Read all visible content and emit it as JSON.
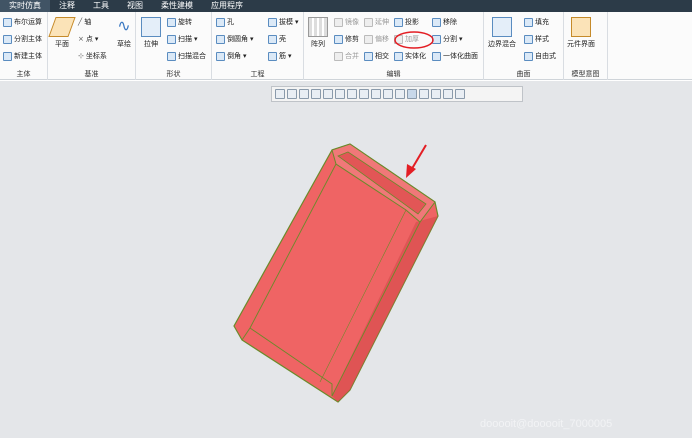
{
  "menu": [
    "实时仿真",
    "注释",
    "工具",
    "视图",
    "柔性建模",
    "应用程序"
  ],
  "ribbon": {
    "groups": {
      "boolean": {
        "label": "主体",
        "items": [
          "布尔运算",
          "分割主体",
          "新建主体"
        ]
      },
      "datum": {
        "label": "基准",
        "plane": "平面",
        "axis": "轴",
        "point": "点",
        "csys": "坐标系",
        "sketch": "草绘"
      },
      "shapes": {
        "label": "形状",
        "extrude": "拉伸",
        "revolve": "旋转",
        "sweep": "扫描",
        "blend": "扫描混合"
      },
      "engineering": {
        "label": "工程",
        "hole": "孔",
        "round": "倒圆角",
        "chamfer": "倒角",
        "draft": "拔模",
        "shell": "壳",
        "rib": "筋"
      },
      "editing": {
        "label": "编辑",
        "pattern": "阵列",
        "mirror": "镜像",
        "trim": "修剪",
        "merge": "合并",
        "extend": "延伸",
        "offset": "偏移",
        "intersect": "相交",
        "project": "投影",
        "thicken": "加厚",
        "solidify": "实体化",
        "remove": "移除",
        "split": "分割",
        "unify": "一体化曲面"
      },
      "surfaces": {
        "label": "曲面",
        "boundary": "边界混合",
        "fill": "填充",
        "style": "样式",
        "freestyle": "自由式"
      },
      "model_intent": {
        "label": "模型意图",
        "component_interface": "元件界面"
      }
    }
  },
  "watermark": "dooooit@dooooit_7000005",
  "highlight_color": "#e31e24",
  "model_color": "#ef6464"
}
